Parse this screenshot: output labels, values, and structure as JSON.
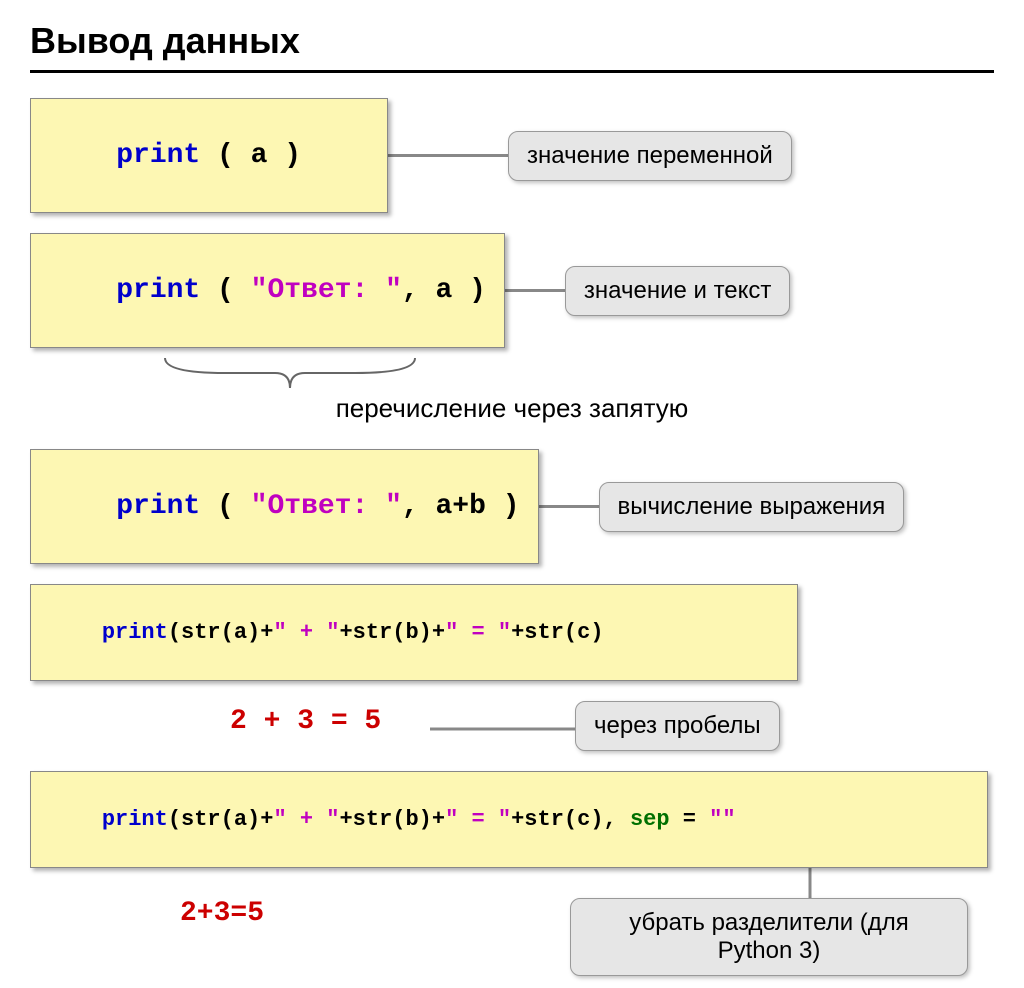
{
  "title": "Вывод данных",
  "code1": {
    "kw": "print",
    "rest": " ( a )"
  },
  "callout1": "значение переменной",
  "code2": {
    "kw": "print",
    "p1": " ( ",
    "str": "\"Ответ: \"",
    "p2": ", a )"
  },
  "callout2": "значение и текст",
  "caption1": "перечисление через запятую",
  "code3": {
    "kw": "print",
    "p1": " ( ",
    "str": "\"Ответ: \"",
    "p2": ", a+b )"
  },
  "callout3": "вычисление выражения",
  "code4": {
    "kw": "print",
    "p1": "(str(a)+",
    "s1": "\" + \"",
    "p2": "+str(b)+",
    "s2": "\" = \"",
    "p3": "+str(c)"
  },
  "calc1": "2 + 3 = 5",
  "callout4": "через пробелы",
  "code5": {
    "kw": "print",
    "p1": "(str(a)+",
    "s1": "\" + \"",
    "p2": "+str(b)+",
    "s2": "\" = \"",
    "p3": "+str(c), ",
    "attr": "sep",
    "p4": " = ",
    "s3": "\"\""
  },
  "calc2": "2+3=5",
  "callout5": "убрать разделители (для Python 3)"
}
